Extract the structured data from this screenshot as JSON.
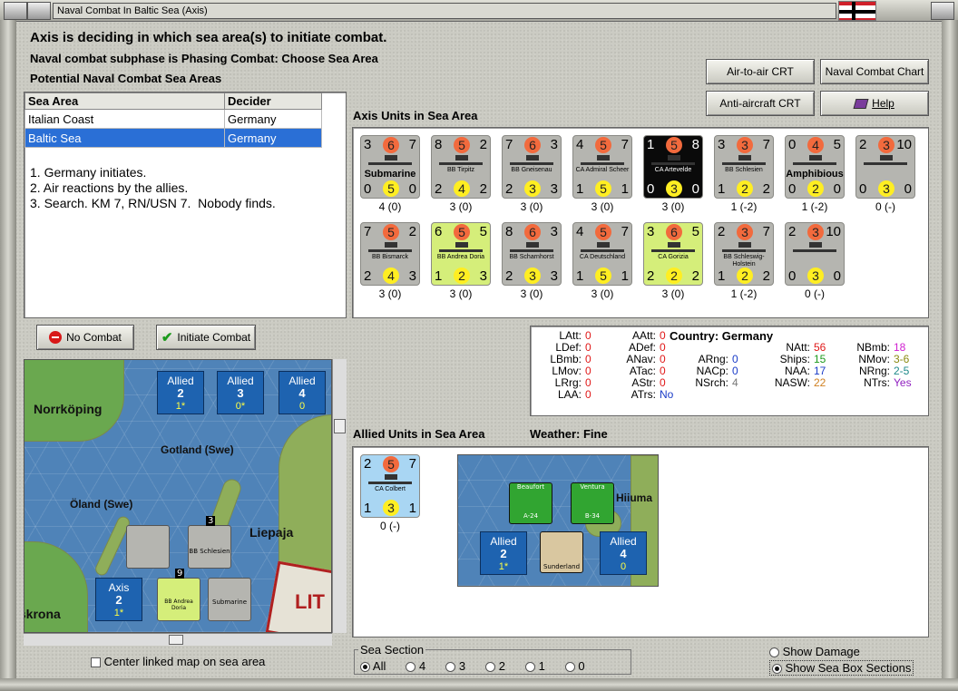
{
  "window": {
    "title": "Naval Combat In Baltic Sea (Axis)"
  },
  "header": {
    "line1": "Axis is deciding in which sea area(s) to initiate combat.",
    "line2": "Naval combat subphase is Phasing Combat: Choose Sea Area",
    "line3": "Potential Naval Combat Sea Areas"
  },
  "charts": {
    "air_to_air": "Air-to-air CRT",
    "naval_chart": "Naval Combat Chart",
    "anti_aircraft": "Anti-aircraft CRT",
    "help": "Help"
  },
  "sea_areas": {
    "headers": [
      "Sea Area",
      "Decider"
    ],
    "rows": [
      {
        "area": "Italian Coast",
        "decider": "Germany"
      },
      {
        "area": "Baltic Sea",
        "decider": "Germany"
      }
    ]
  },
  "notes": [
    "1. Germany initiates.",
    "2. Air reactions by the allies.",
    "3. Search. KM 7, RN/USN 7.  Nobody finds."
  ],
  "axis_title": "Axis Units in Sea Area",
  "axis_units": [
    {
      "tl": "3",
      "tm": "6",
      "tr": "7",
      "name": "Submarine",
      "bl": "0",
      "bm": "5",
      "br": "0",
      "status": "4 (0)",
      "style": "big"
    },
    {
      "tl": "8",
      "tm": "5",
      "tr": "2",
      "name": "BB Tirpitz",
      "bl": "2",
      "bm": "4",
      "br": "2",
      "status": "3 (0)",
      "style": ""
    },
    {
      "tl": "7",
      "tm": "6",
      "tr": "3",
      "name": "BB Gneisenau",
      "bl": "2",
      "bm": "3",
      "br": "3",
      "status": "3 (0)",
      "style": ""
    },
    {
      "tl": "4",
      "tm": "5",
      "tr": "7",
      "name": "CA Admiral Scheer",
      "bl": "1",
      "bm": "5",
      "br": "1",
      "status": "3 (0)",
      "style": ""
    },
    {
      "tl": "1",
      "tm": "5",
      "tr": "8",
      "name": "CA Artevelde",
      "bl": "0",
      "bm": "3",
      "br": "0",
      "status": "3 (0)",
      "style": "black"
    },
    {
      "tl": "3",
      "tm": "3",
      "tr": "7",
      "name": "BB Schlesien",
      "bl": "1",
      "bm": "2",
      "br": "2",
      "status": "1 (-2)",
      "style": ""
    },
    {
      "tl": "0",
      "tm": "4",
      "tr": "5",
      "name": "Amphibious",
      "bl": "0",
      "bm": "2",
      "br": "0",
      "status": "1 (-2)",
      "style": "big"
    },
    {
      "tl": "2",
      "tm": "3",
      "tr": "10",
      "name": "",
      "bl": "0",
      "bm": "3",
      "br": "0",
      "status": "0 (-)",
      "style": ""
    },
    {
      "tl": "7",
      "tm": "5",
      "tr": "2",
      "name": "BB Bismarck",
      "bl": "2",
      "bm": "4",
      "br": "3",
      "status": "3 (0)",
      "style": ""
    },
    {
      "tl": "6",
      "tm": "5",
      "tr": "5",
      "name": "BB Andrea Doria",
      "bl": "1",
      "bm": "2",
      "br": "3",
      "status": "3 (0)",
      "style": "green"
    },
    {
      "tl": "8",
      "tm": "6",
      "tr": "3",
      "name": "BB Scharnhorst",
      "bl": "2",
      "bm": "3",
      "br": "3",
      "status": "3 (0)",
      "style": ""
    },
    {
      "tl": "4",
      "tm": "5",
      "tr": "7",
      "name": "CA Deutschland",
      "bl": "1",
      "bm": "5",
      "br": "1",
      "status": "3 (0)",
      "style": ""
    },
    {
      "tl": "3",
      "tm": "6",
      "tr": "5",
      "name": "CA Gorizia",
      "bl": "2",
      "bm": "2",
      "br": "2",
      "status": "3 (0)",
      "style": "green"
    },
    {
      "tl": "2",
      "tm": "3",
      "tr": "7",
      "name": "BB Schleswig-Holstein",
      "bl": "1",
      "bm": "2",
      "br": "2",
      "status": "1 (-2)",
      "style": ""
    },
    {
      "tl": "2",
      "tm": "3",
      "tr": "10",
      "name": "",
      "bl": "0",
      "bm": "3",
      "br": "0",
      "status": "0 (-)",
      "style": ""
    }
  ],
  "actions": {
    "no_combat": "No Combat",
    "initiate": "Initiate Combat"
  },
  "map": {
    "places": [
      "Norrköping",
      "Gotland (Swe)",
      "Öland (Swe)",
      "Liepaja",
      "lskrona",
      "LIT"
    ],
    "boxes": [
      {
        "side": "Allied",
        "num": "2",
        "sub": "1*"
      },
      {
        "side": "Allied",
        "num": "3",
        "sub": "0*"
      },
      {
        "side": "Allied",
        "num": "4",
        "sub": "0"
      },
      {
        "side": "Axis",
        "num": "2",
        "sub": "1*"
      }
    ],
    "stack_labels": [
      "3",
      "9",
      "3",
      "BB Schlesien",
      "BB Andrea Doria",
      "Submarine"
    ],
    "center_label": "Center linked map on sea area"
  },
  "stats": {
    "col1": [
      [
        "LAtt:",
        "0"
      ],
      [
        "LDef:",
        "0"
      ],
      [
        "LBmb:",
        "0"
      ],
      [
        "LMov:",
        "0"
      ],
      [
        "LRrg:",
        "0"
      ],
      [
        "LAA:",
        "0"
      ]
    ],
    "col2": [
      [
        "AAtt:",
        "0"
      ],
      [
        "ADef:",
        "0"
      ],
      [
        "ANav:",
        "0"
      ],
      [
        "ATac:",
        "0"
      ],
      [
        "AStr:",
        "0"
      ],
      [
        "ATrs:",
        "No"
      ]
    ],
    "country_label": "Country: Germany",
    "col3": [
      [
        "ARng:",
        "0"
      ],
      [
        "NACp:",
        "0"
      ],
      [
        "NSrch:",
        "4"
      ]
    ],
    "col4": [
      [
        "NAtt:",
        "56"
      ],
      [
        "Ships:",
        "15"
      ],
      [
        "NAA:",
        "17"
      ],
      [
        "NASW:",
        "22"
      ]
    ],
    "col5": [
      [
        "NBmb:",
        "18"
      ],
      [
        "NMov:",
        "3-6"
      ],
      [
        "NRng:",
        "2-5"
      ],
      [
        "NTrs:",
        "Yes"
      ]
    ],
    "colors": {
      "red": "#e01818",
      "blue": "#1a3cc8",
      "green": "#1c9a1c",
      "gray": "#777777",
      "magenta": "#d020d0",
      "orange": "#d08020",
      "olive": "#8a8a10",
      "teal": "#1f8a8a",
      "purple": "#9020c0"
    }
  },
  "allied_title": "Allied Units in Sea Area",
  "weather": "Weather:  Fine",
  "allied_unit": {
    "tl": "2",
    "tm": "5",
    "tr": "7",
    "name": "CA Colbert",
    "bl": "1",
    "bm": "3",
    "br": "1",
    "status": "0 (-)"
  },
  "allied_map": {
    "place": "Hiiuma",
    "boxes": [
      {
        "side": "Allied",
        "num": "2",
        "sub": "1*"
      },
      {
        "side": "Allied",
        "num": "4",
        "sub": "0"
      }
    ],
    "counters": [
      "Beaufort",
      "A-24",
      "Ventura",
      "B-34",
      "Sunderland"
    ],
    "nums": [
      "2",
      "6",
      "2",
      "6",
      "3",
      "2",
      "20",
      "1"
    ]
  },
  "sea_section": {
    "title": "Sea Section",
    "options": [
      "All",
      "4",
      "3",
      "2",
      "1",
      "0"
    ],
    "selected": "All"
  },
  "options": {
    "show_damage": "Show Damage",
    "show_sea_box": "Show Sea Box Sections"
  }
}
